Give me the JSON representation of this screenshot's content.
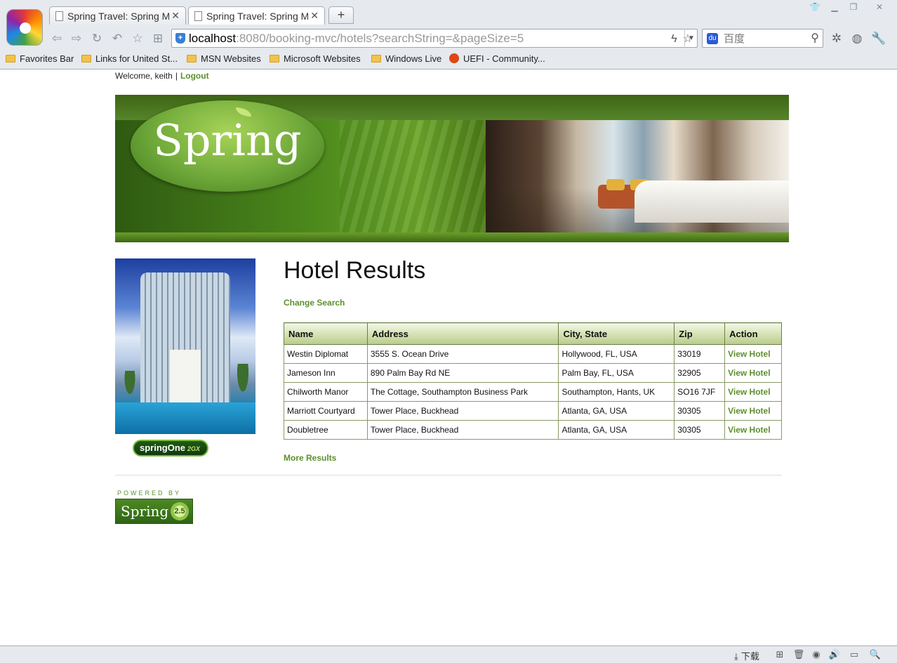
{
  "browser": {
    "tabs": [
      {
        "title": "Spring Travel: Spring MV"
      },
      {
        "title": "Spring Travel: Spring MV"
      }
    ],
    "url_host": "localhost",
    "url_rest": ":8080/booking-mvc/hotels?searchString=&pageSize=5",
    "search_placeholder": "百度",
    "bookmarks": [
      {
        "label": "Favorites Bar"
      },
      {
        "label": "Links for United St..."
      },
      {
        "label": "MSN Websites"
      },
      {
        "label": "Microsoft Websites"
      },
      {
        "label": "Windows Live"
      },
      {
        "label": "UEFI - Community..."
      }
    ],
    "status": {
      "download_label": "下载"
    }
  },
  "page": {
    "welcome_text": "Welcome, keith",
    "separator": "|",
    "logout_label": "Logout",
    "banner_logo_text": "Spring",
    "title": "Hotel Results",
    "change_search_label": "Change Search",
    "more_results_label": "More Results",
    "springone_badge": {
      "text": "springOne",
      "suffix": "2GX"
    },
    "powered_by_label": "POWERED BY",
    "powered_by_logo_text": "Spring",
    "powered_by_badge": "2.5",
    "table": {
      "columns": [
        "Name",
        "Address",
        "City, State",
        "Zip",
        "Action"
      ],
      "rows": [
        {
          "name": "Westin Diplomat",
          "address": "3555 S. Ocean Drive",
          "city_state": "Hollywood, FL, USA",
          "zip": "33019",
          "action": "View Hotel"
        },
        {
          "name": "Jameson Inn",
          "address": "890 Palm Bay Rd NE",
          "city_state": "Palm Bay, FL, USA",
          "zip": "32905",
          "action": "View Hotel"
        },
        {
          "name": "Chilworth Manor",
          "address": "The Cottage, Southampton Business Park",
          "city_state": "Southampton, Hants, UK",
          "zip": "SO16 7JF",
          "action": "View Hotel"
        },
        {
          "name": "Marriott Courtyard",
          "address": "Tower Place, Buckhead",
          "city_state": "Atlanta, GA, USA",
          "zip": "30305",
          "action": "View Hotel"
        },
        {
          "name": "Doubletree",
          "address": "Tower Place, Buckhead",
          "city_state": "Atlanta, GA, USA",
          "zip": "30305",
          "action": "View Hotel"
        }
      ]
    }
  },
  "colors": {
    "link_green": "#5c8f2d",
    "table_border": "#556b2f",
    "header_gradient_bottom": "#b9cc8c"
  }
}
